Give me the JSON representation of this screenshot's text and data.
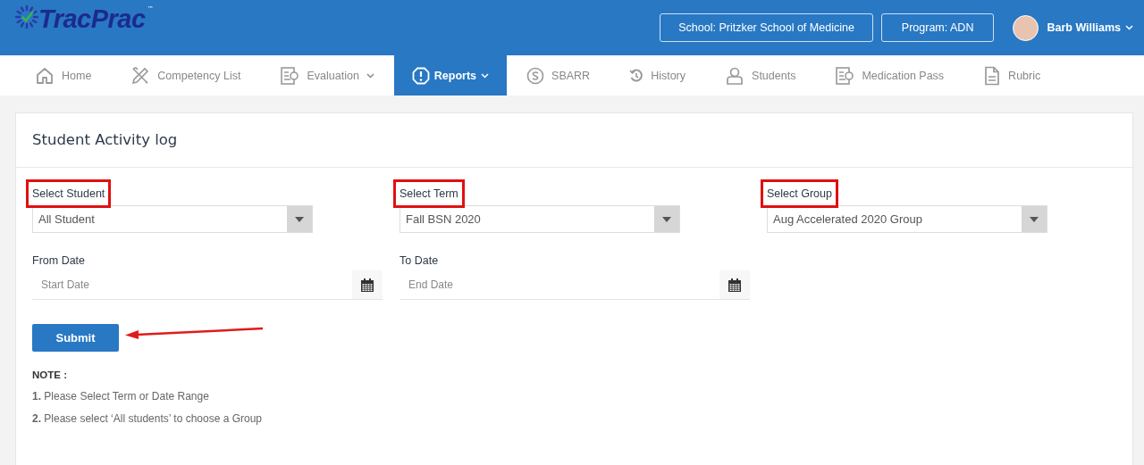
{
  "header": {
    "logo": {
      "name": "TracPrac",
      "mark": "™"
    },
    "school_button": "School: Pritzker School of Medicine",
    "program_button": "Program: ADN",
    "user": {
      "name": "Barb Williams"
    }
  },
  "nav": [
    {
      "label": "Home",
      "kind": "home",
      "dropdown": false,
      "selected": false
    },
    {
      "label": "Competency List",
      "kind": "tools",
      "dropdown": false,
      "selected": false
    },
    {
      "label": "Evaluation",
      "kind": "form",
      "dropdown": true,
      "selected": false
    },
    {
      "label": "Reports",
      "kind": "alert",
      "dropdown": true,
      "selected": true
    },
    {
      "label": "SBARR",
      "kind": "dollar",
      "dropdown": false,
      "selected": false
    },
    {
      "label": "History",
      "kind": "history",
      "dropdown": false,
      "selected": false
    },
    {
      "label": "Students",
      "kind": "user",
      "dropdown": false,
      "selected": false
    },
    {
      "label": "Medication Pass",
      "kind": "form",
      "dropdown": false,
      "selected": false
    },
    {
      "label": "Rubric",
      "kind": "doc",
      "dropdown": false,
      "selected": false
    }
  ],
  "card": {
    "title": "Student Activity log",
    "selects": [
      {
        "label": "Select Student",
        "value": "All Student",
        "highlighted": true
      },
      {
        "label": "Select Term",
        "value": "Fall BSN 2020",
        "highlighted": true
      },
      {
        "label": "Select Group",
        "value": "Aug Accelerated 2020 Group",
        "highlighted": true
      }
    ],
    "dates": [
      {
        "label": "From Date",
        "placeholder": "Start Date"
      },
      {
        "label": "To Date",
        "placeholder": "End Date"
      }
    ],
    "submit": {
      "label": "Submit",
      "pointer_arrow": true
    },
    "note_title": "NOTE :",
    "notes": [
      "**1.** Please Select Term or Date Range",
      "**2.** Please select ‘All students’ to choose a Group"
    ]
  }
}
